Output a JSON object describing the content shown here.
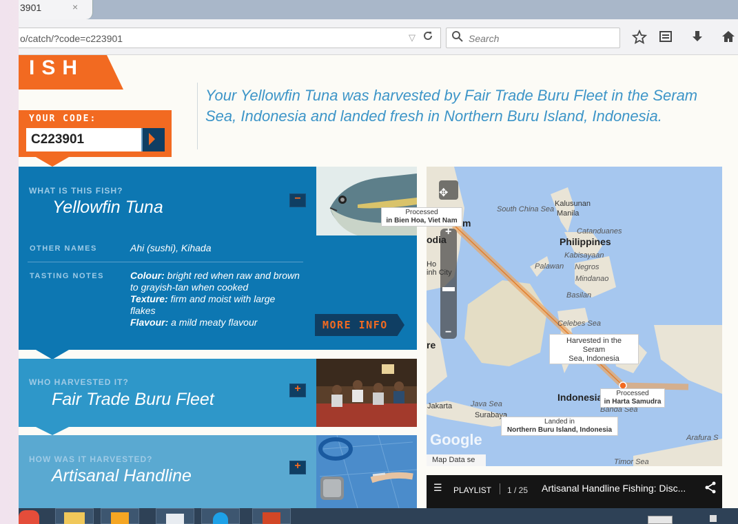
{
  "browser": {
    "tab_title": "3901",
    "tab_close": "×",
    "url": "o/catch/?code=c223901",
    "search_placeholder": "Search",
    "url_dropdown": "▽",
    "reload": "C"
  },
  "logo_text": "ISH",
  "code_box": {
    "label": "YOUR CODE:",
    "value": "C223901"
  },
  "intro": "Your Yellowfin Tuna was harvested by Fair Trade Buru Fleet in the Seram Sea, Indonesia and landed fresh in Northern Buru Island, Indonesia.",
  "panels": {
    "what": {
      "label": "WHAT IS THIS FISH?",
      "value": "Yellowfin Tuna",
      "toggle": "−",
      "other_names_label": "OTHER NAMES",
      "other_names": "Ahi (sushi), Kihada",
      "tasting_label": "TASTING NOTES",
      "colour_label": "Colour:",
      "colour": "bright red when raw and brown to grayish-tan when cooked",
      "texture_label": "Texture:",
      "texture": "firm and moist with large flakes",
      "flavour_label": "Flavour:",
      "flavour": "a mild meaty flavour",
      "more_info": "MORE INFO"
    },
    "who": {
      "label": "WHO HARVESTED IT?",
      "value": "Fair Trade Buru Fleet",
      "toggle": "+"
    },
    "how": {
      "label": "HOW WAS IT HARVESTED?",
      "value": "Artisanal Handline",
      "toggle": "+"
    }
  },
  "map": {
    "labels": {
      "south_china_sea": "South China Sea",
      "kalusunan": "Kalusunan",
      "manila": "Manila",
      "catanduanes": "Catanduanes",
      "philippines": "Philippines",
      "kabisayaan": "Kabisayaan",
      "palawan": "Palawan",
      "negros": "Negros",
      "mindanao": "Mindanao",
      "basilan": "Basilan",
      "celebes_sea": "Celebes Sea",
      "jakarta": "Jakarta",
      "java_sea": "Java Sea",
      "surabaya": "Surabaya",
      "indonesia": "Indonesia",
      "banda_sea": "Banda Sea",
      "arafura": "Arafura S",
      "timor_sea": "Timor Sea",
      "left_m": "m",
      "left_odia": "odia",
      "left_ho": "Ho",
      "left_inh": "inh City",
      "left_re": "re",
      "google": "Google",
      "map_data": "Map Data",
      "map_data_tail": "se"
    },
    "markers": {
      "processed_vn_1": "Processed",
      "processed_vn_2": "in Bien Hoa, Viet Nam",
      "harvested_1": "Harvested in the",
      "harvested_2": "Seram",
      "harvested_3": "Sea, Indonesia",
      "processed_id_1": "Processed",
      "processed_id_2": "in Harta Samudra",
      "landed_1": "Landed in",
      "landed_2": "Northern Buru Island, Indonesia"
    }
  },
  "video": {
    "playlist_label": "PLAYLIST",
    "counter": "1 / 25",
    "title": "Artisanal Handline Fishing: Disc..."
  },
  "colors": {
    "orange": "#f26a21",
    "blue_dark": "#0d77b2",
    "blue_mid": "#2e97c9",
    "blue_light": "#5aa9d1",
    "navy": "#0f3e63",
    "intro_text": "#3d95c8"
  }
}
